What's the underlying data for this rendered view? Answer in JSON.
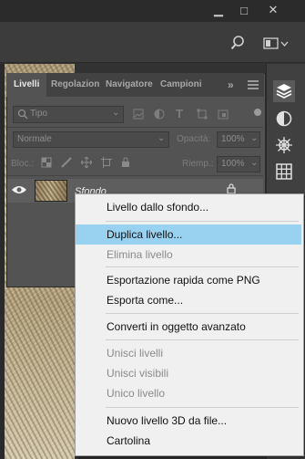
{
  "window": {
    "minimize": "▁",
    "maximize": "□",
    "close": "✕"
  },
  "panel": {
    "tabs": [
      "Livelli",
      "Regolazioni",
      "Navigatore",
      "Campioni"
    ],
    "more": "»",
    "filter": {
      "placeholder": "Tipo"
    },
    "blend_mode": "Normale",
    "opacity_label": "Opacità:",
    "opacity_value": "100%",
    "lock_label": "Bloc.:",
    "fill_label": "Riemp.:",
    "fill_value": "100%",
    "layer": {
      "name": "Sfondo"
    }
  },
  "menu": {
    "items": [
      {
        "label": "Livello dallo sfondo...",
        "state": "enabled"
      },
      {
        "label": "Duplica livello...",
        "state": "highlighted"
      },
      {
        "label": "Elimina livello",
        "state": "disabled"
      },
      {
        "label": "Esportazione rapida come PNG",
        "state": "enabled"
      },
      {
        "label": "Esporta come...",
        "state": "enabled"
      },
      {
        "label": "Converti in oggetto avanzato",
        "state": "enabled"
      },
      {
        "label": "Unisci livelli",
        "state": "disabled"
      },
      {
        "label": "Unisci visibili",
        "state": "disabled"
      },
      {
        "label": "Unico livello",
        "state": "disabled"
      },
      {
        "label": "Nuovo livello 3D da file...",
        "state": "enabled"
      },
      {
        "label": "Cartolina",
        "state": "enabled"
      }
    ]
  },
  "colors": {
    "highlight": "#99d1f1",
    "panel": "#535353",
    "menu_bg": "#f0f0f0"
  }
}
